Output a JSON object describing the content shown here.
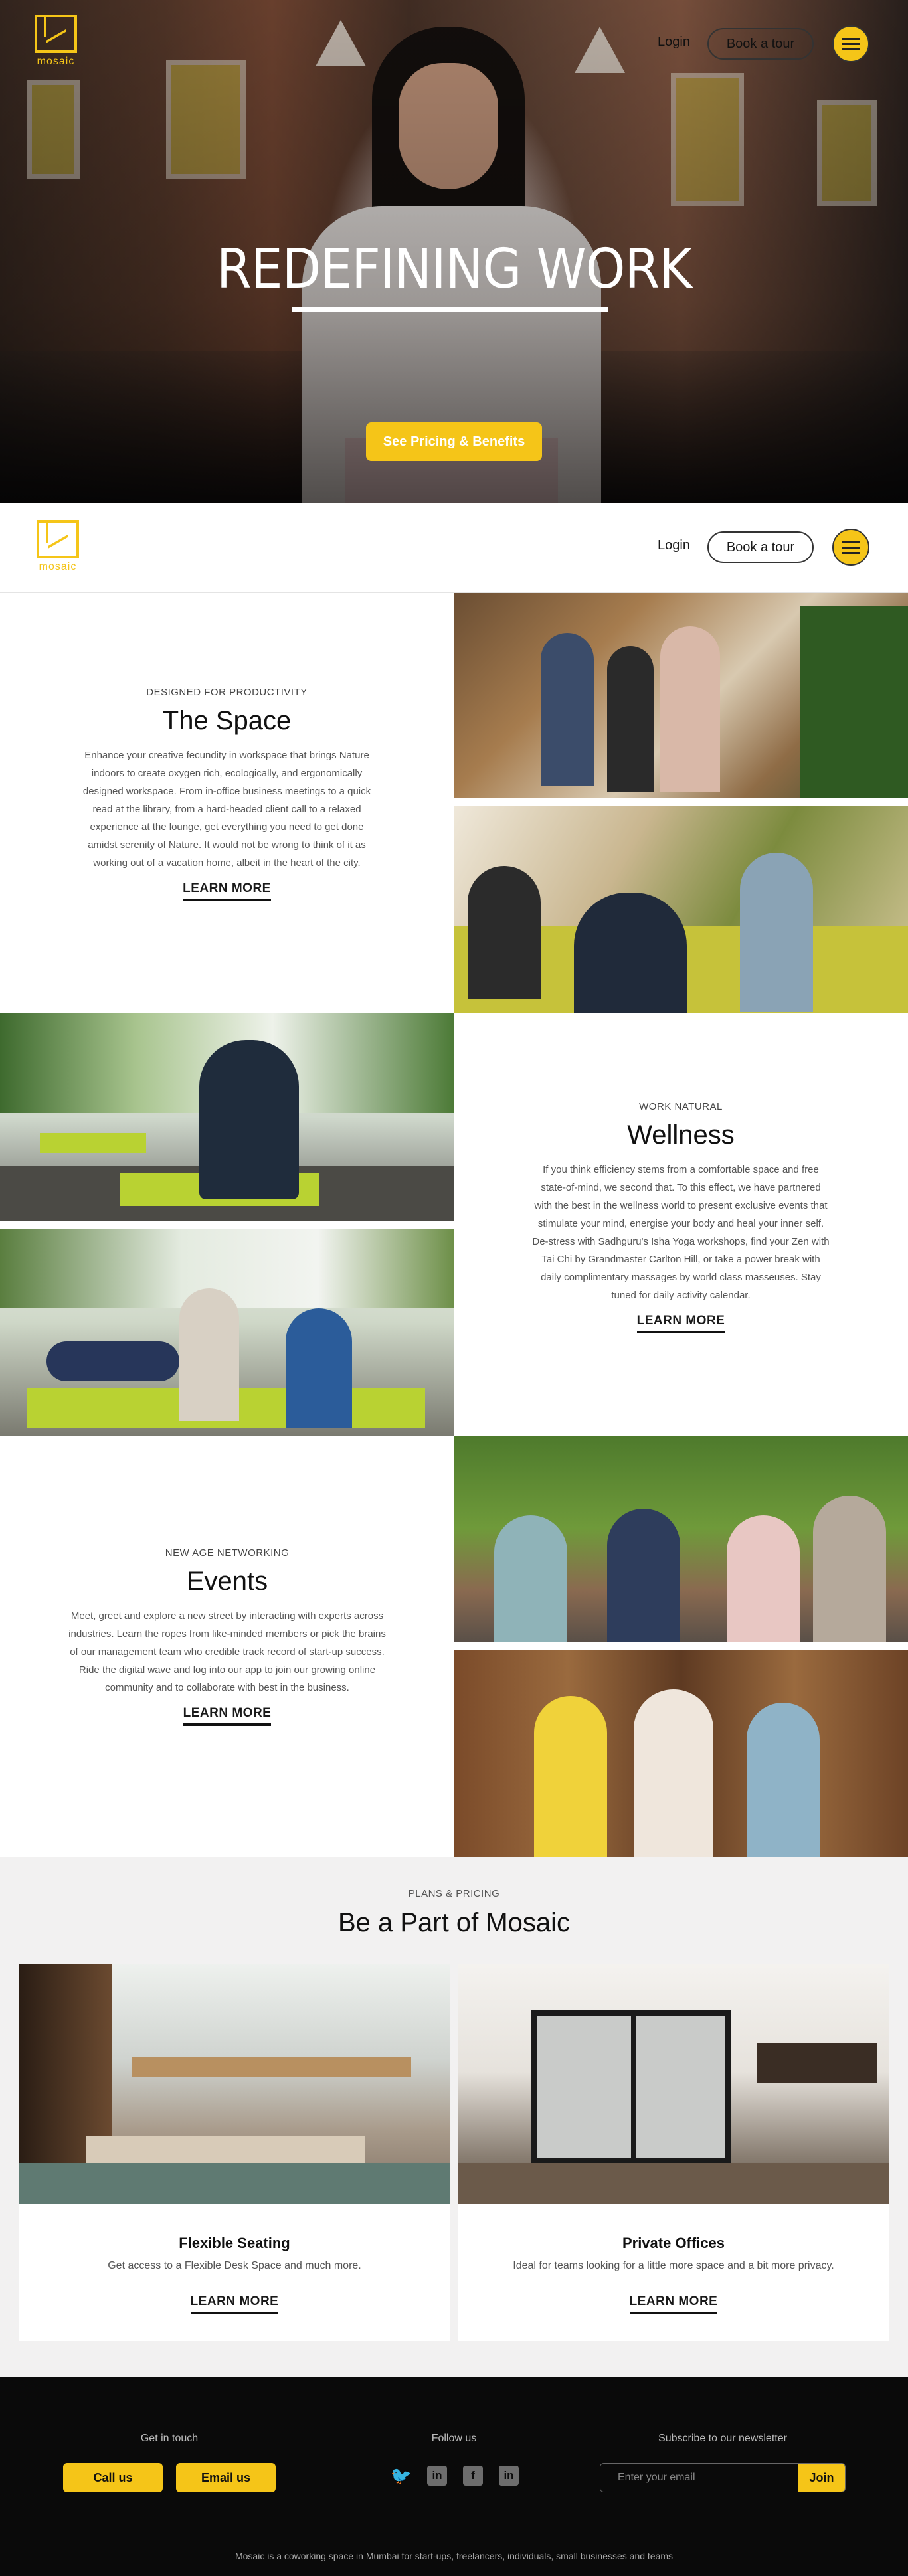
{
  "brand": {
    "name": "mosaic",
    "accent": "#f5c518"
  },
  "nav": {
    "login": "Login",
    "tour": "Book a tour"
  },
  "hero": {
    "title": "REDEFINING WORK",
    "cta": "See Pricing & Benefits"
  },
  "features": [
    {
      "eyebrow": "DESIGNED FOR PRODUCTIVITY",
      "title": "The Space",
      "body": "Enhance your creative fecundity in workspace that brings Nature indoors to create oxygen rich, ecologically, and ergonomically designed workspace. From in-office business meetings to a quick read at the library, from a hard-headed client call to a relaxed experience at the lounge, get everything you need to get done amidst serenity of Nature. It would not be wrong to think of it as working out of a vacation home, albeit in the heart of the city.",
      "link": "LEARN MORE"
    },
    {
      "eyebrow": "WORK NATURAL",
      "title": "Wellness",
      "body": "If you think efficiency stems from a comfortable space and free state-of-mind, we second that. To this effect, we have partnered with the best in the wellness world to present exclusive events that stimulate your mind, energise your body and heal your inner self. De-stress with Sadhguru's Isha Yoga workshops, find your Zen with Tai Chi by Grandmaster Carlton Hill, or take a power break with daily complimentary massages by world class masseuses. Stay tuned for daily activity calendar.",
      "link": "LEARN MORE"
    },
    {
      "eyebrow": "NEW AGE NETWORKING",
      "title": "Events",
      "body": "Meet, greet and explore a new street by interacting with experts across industries. Learn the ropes from like-minded members or pick the brains of our management team who credible track record of start-up success. Ride the digital wave and log into our app to join our growing online community and to collaborate with best in the business.",
      "link": "LEARN MORE"
    }
  ],
  "plans": {
    "eyebrow": "PLANS & PRICING",
    "title": "Be a Part of Mosaic",
    "cards": [
      {
        "title": "Flexible Seating",
        "desc": "Get access to a Flexible Desk Space and much more.",
        "link": "LEARN MORE"
      },
      {
        "title": "Private Offices",
        "desc": "Ideal for teams looking for a little more space and a bit more privacy.",
        "link": "LEARN MORE"
      }
    ]
  },
  "footer": {
    "contact_title": "Get in touch",
    "call": "Call us",
    "email": "Email us",
    "follow_title": "Follow us",
    "social": [
      "twitter-icon",
      "linkedin-icon",
      "facebook-icon",
      "linkedin-icon"
    ],
    "newsletter_title": "Subscribe to our newsletter",
    "newsletter_placeholder": "Enter your email",
    "join": "Join",
    "note": "Mosaic is a coworking space in Mumbai for start-ups, freelancers, individuals, small businesses and teams"
  }
}
